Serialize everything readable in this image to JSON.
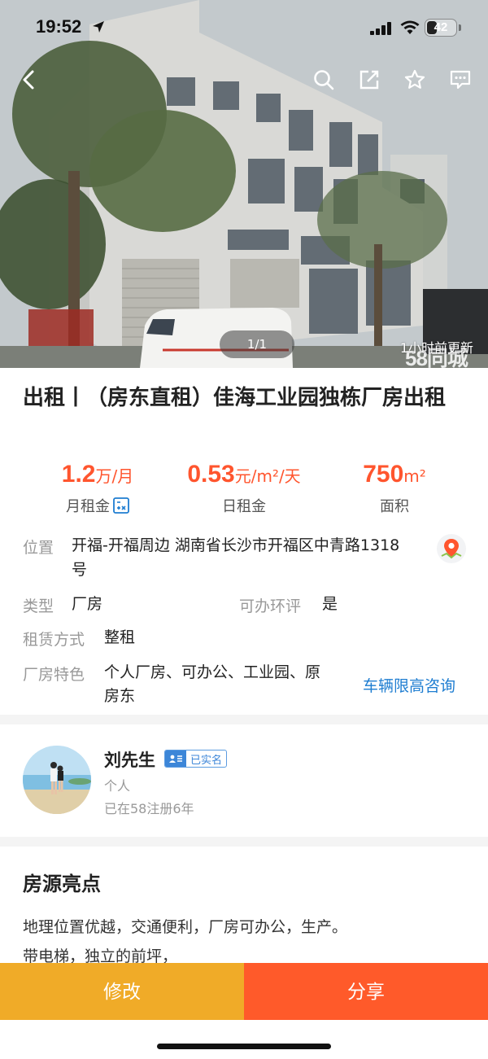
{
  "status_bar": {
    "time": "19:52",
    "battery": "42",
    "battery_level": 0.42
  },
  "hero": {
    "photo_counter": "1/1",
    "update_time": "1小时前更新",
    "watermark": "58同城"
  },
  "nav": {
    "icons": [
      "back-icon",
      "search-icon",
      "share-icon",
      "favorite-star-icon",
      "message-icon"
    ]
  },
  "listing": {
    "title": "出租丨（房东直租）佳海工业园独栋厂房出租",
    "monthly_rent": {
      "value": "1.2",
      "unit": "万/月",
      "label": "月租金"
    },
    "daily_rent": {
      "value": "0.53",
      "unit": "元/m²/天",
      "label": "日租金"
    },
    "area": {
      "value": "750",
      "unit": "m²",
      "label": "面积"
    }
  },
  "details": {
    "location_label": "位置",
    "location_line1": "开福-开福周边 湖南省长沙市开福区中青路1318",
    "location_line2": "号",
    "type_label": "类型",
    "type_value": "厂房",
    "eia_label": "可办环评",
    "eia_value": "是",
    "lease_label": "租赁方式",
    "lease_value": "整租",
    "features_label": "厂房特色",
    "features_line1": "个人厂房、可办公、工业园、原",
    "features_line2": "房东",
    "vehicle_link": "车辆限高咨询"
  },
  "landlord": {
    "name": "刘先生",
    "verified": "已实名",
    "type": "个人",
    "registered": "已在58注册6年"
  },
  "highlights": {
    "title": "房源亮点",
    "line1": "地理位置优越，交通便利，厂房可办公，生产。",
    "line2": "带电梯，独立的前坪，"
  },
  "actions": {
    "edit": "修改",
    "share": "分享"
  },
  "colors": {
    "accent": "#ff552e",
    "edit_button": "#f0ab28",
    "share_button": "#ff5a2a",
    "link": "#1e7dd1"
  }
}
